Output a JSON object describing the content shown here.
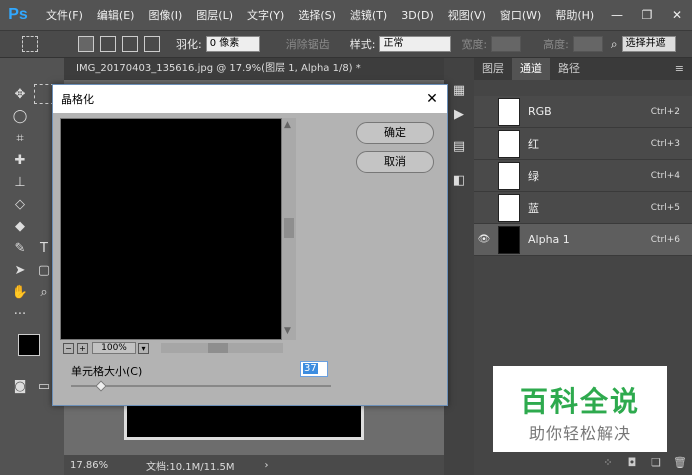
{
  "app": {
    "logo": "Ps"
  },
  "menubar": {
    "items": [
      "文件(F)",
      "编辑(E)",
      "图像(I)",
      "图层(L)",
      "文字(Y)",
      "选择(S)",
      "滤镜(T)",
      "3D(D)",
      "视图(V)",
      "窗口(W)",
      "帮助(H)"
    ],
    "controls": {
      "min": "—",
      "max": "❐",
      "close": "✕"
    }
  },
  "options": {
    "feather_label": "羽化:",
    "feather_value": "0 像素",
    "antialias": "消除锯齿",
    "style_label": "样式:",
    "style_value": "正常",
    "width_label": "宽度:",
    "height_label": "高度:",
    "select_mask": "选择并遮"
  },
  "document": {
    "tab_title": "IMG_20170403_135616.jpg @ 17.9%(图层 1, Alpha 1/8) *",
    "zoom": "17.86%",
    "doc_info": "文档:10.1M/11.5M"
  },
  "panel": {
    "tabs": [
      "图层",
      "通道",
      "路径"
    ],
    "channels": [
      {
        "name": "RGB",
        "shortcut": "Ctrl+2"
      },
      {
        "name": "红",
        "shortcut": "Ctrl+3"
      },
      {
        "name": "绿",
        "shortcut": "Ctrl+4"
      },
      {
        "name": "蓝",
        "shortcut": "Ctrl+5"
      },
      {
        "name": "Alpha 1",
        "shortcut": "Ctrl+6"
      }
    ]
  },
  "dialog": {
    "title": "晶格化",
    "ok": "确定",
    "cancel": "取消",
    "zoom": "100%",
    "cell_size_label": "单元格大小(C)",
    "cell_size_value": "37"
  },
  "watermark": {
    "title": "百科全说",
    "subtitle": "助你轻松解决"
  },
  "colors": {
    "accent": "#31a8ff",
    "watermark_green": "#2eaa4e"
  }
}
